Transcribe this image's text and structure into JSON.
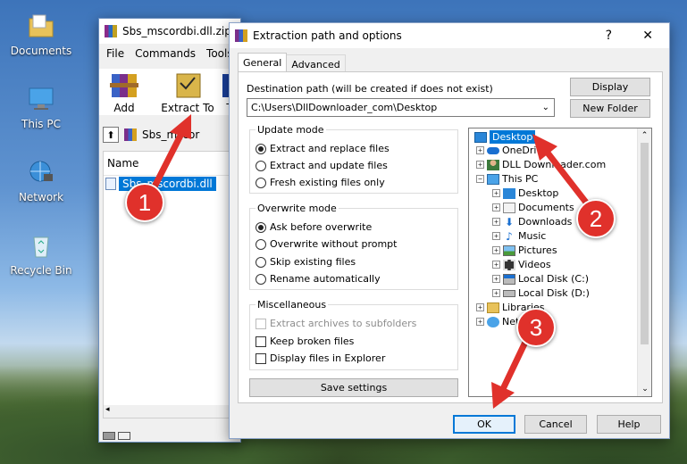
{
  "desktop": {
    "icons": [
      {
        "label": "Documents"
      },
      {
        "label": "This PC"
      },
      {
        "label": "Network"
      },
      {
        "label": "Recycle Bin"
      }
    ]
  },
  "winrar": {
    "title": "Sbs_mscordbi.dll.zip",
    "menu": [
      "File",
      "Commands",
      "Tools"
    ],
    "toolbar": {
      "add": "Add",
      "extract_to": "Extract To",
      "partial": "T"
    },
    "path_value": "Sbs_mscor",
    "column_name": "Name",
    "selected_file": "Sbs_mscordbi.dll"
  },
  "dialog": {
    "title": "Extraction path and options",
    "help_glyph": "?",
    "close_glyph": "✕",
    "tabs": [
      "General",
      "Advanced"
    ],
    "dest_label": "Destination path (will be created if does not exist)",
    "dest_value": "C:\\Users\\DllDownloader_com\\Desktop",
    "display_btn": "Display",
    "new_folder_btn": "New Folder",
    "update_mode": {
      "title": "Update mode",
      "options": [
        "Extract and replace files",
        "Extract and update files",
        "Fresh existing files only"
      ],
      "selected": 0
    },
    "overwrite_mode": {
      "title": "Overwrite mode",
      "options": [
        "Ask before overwrite",
        "Overwrite without prompt",
        "Skip existing files",
        "Rename automatically"
      ],
      "selected": 0
    },
    "misc": {
      "title": "Miscellaneous",
      "options": [
        "Extract archives to subfolders",
        "Keep broken files",
        "Display files in Explorer"
      ],
      "disabled": [
        true,
        false,
        false
      ]
    },
    "save_settings": "Save settings",
    "tree": [
      {
        "label": "Desktop",
        "selected": true,
        "icon": "desktop-icon",
        "expander": ""
      },
      {
        "label": "OneDri",
        "icon": "cloud-icon",
        "expander": "+"
      },
      {
        "label": "DLL Downloader.com",
        "icon": "user-icon",
        "expander": "+"
      },
      {
        "label": "This PC",
        "icon": "pc-icon",
        "expander": "−"
      },
      {
        "label": "Desktop",
        "icon": "desktop-icon",
        "expander": "+"
      },
      {
        "label": "Documents",
        "icon": "documents-icon",
        "expander": "+"
      },
      {
        "label": "Downloads",
        "icon": "downloads-icon",
        "expander": "+"
      },
      {
        "label": "Music",
        "icon": "music-icon",
        "expander": "+"
      },
      {
        "label": "Pictures",
        "icon": "pictures-icon",
        "expander": "+"
      },
      {
        "label": "Videos",
        "icon": "videos-icon",
        "expander": "+"
      },
      {
        "label": "Local Disk (C:)",
        "icon": "disk-icon",
        "expander": "+"
      },
      {
        "label": "Local Disk (D:)",
        "icon": "disk-icon",
        "expander": "+"
      },
      {
        "label": "Libraries",
        "icon": "libraries-icon",
        "expander": "+"
      },
      {
        "label": "Net",
        "icon": "network-icon",
        "expander": "+"
      }
    ],
    "ok": "OK",
    "cancel": "Cancel",
    "help": "Help"
  },
  "annotations": [
    "1",
    "2",
    "3"
  ],
  "colors": {
    "accent": "#0078d7",
    "badge": "#e0312b",
    "selection": "#0078d7"
  }
}
